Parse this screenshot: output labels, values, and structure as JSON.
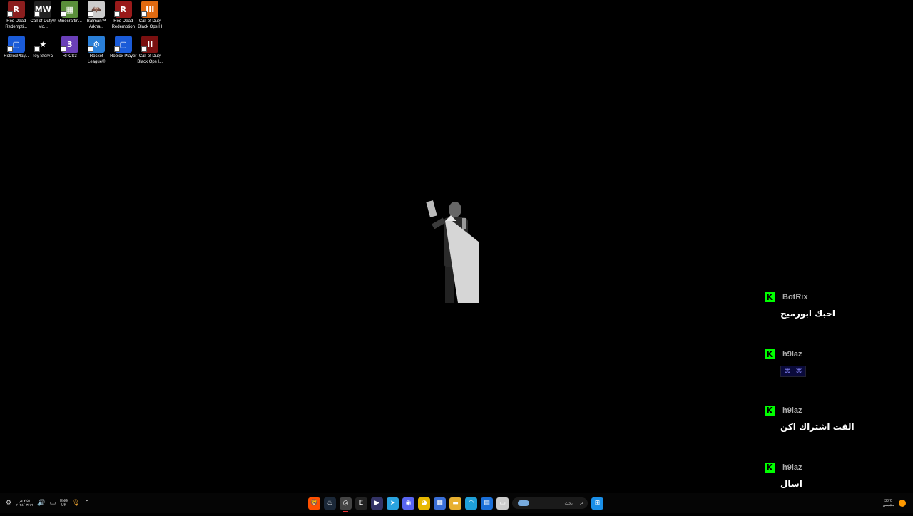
{
  "desktop": {
    "icons": [
      {
        "label": "Red Dead Redempti...",
        "icon": "red-dead-redemption-icon",
        "color": "#8b1e1e",
        "glyph": "R"
      },
      {
        "label": "Call of Duty® Mo...",
        "icon": "modern-warfare-icon",
        "color": "#222222",
        "glyph": "MW"
      },
      {
        "label": "Minecraftin...",
        "icon": "minecraft-icon",
        "color": "#5a8f3a",
        "glyph": "▦"
      },
      {
        "label": "Batman™ Arkha...",
        "icon": "batman-icon",
        "color": "#cccccc",
        "glyph": "🦇"
      },
      {
        "label": "Red Dead Redemption",
        "icon": "red-dead-redemption-icon",
        "color": "#9a1a1a",
        "glyph": "R"
      },
      {
        "label": "Call of Duty Black Ops III",
        "icon": "black-ops-iii-icon",
        "color": "#e06a10",
        "glyph": "III"
      },
      {
        "label": "RobloxPlay...",
        "icon": "roblox-icon",
        "color": "#1a5bd8",
        "glyph": "▢"
      },
      {
        "label": "Toy Story 3",
        "icon": "toy-story-icon",
        "color": "#000000",
        "glyph": "★"
      },
      {
        "label": "RPCS3",
        "icon": "rpcs3-icon",
        "color": "#6a3fb8",
        "glyph": "3"
      },
      {
        "label": "Rocket League®",
        "icon": "rocket-league-icon",
        "color": "#2a7fd8",
        "glyph": "⚙"
      },
      {
        "label": "Roblox Player",
        "icon": "roblox-icon",
        "color": "#1a5bd8",
        "glyph": "▢"
      },
      {
        "label": "Call of Duty Black Ops I...",
        "icon": "black-ops-icon",
        "color": "#7a1010",
        "glyph": "II"
      }
    ]
  },
  "chat": {
    "badge": "K",
    "badge_color": "#00ff00",
    "messages": [
      {
        "user": "BotRix",
        "text": "احبك ابورميح"
      },
      {
        "user": "h9laz",
        "text": "",
        "emotes": [
          "emote",
          "emote"
        ]
      },
      {
        "user": "h9laz",
        "text": "القت اشتراك اكن"
      },
      {
        "user": "h9laz",
        "text": "اسال"
      }
    ]
  },
  "taskbar": {
    "left": {
      "time": "٧:٥١ ص",
      "date": "٢٠٢٤/٠٣/١٦",
      "language": "ENG",
      "region": "UK"
    },
    "apps": [
      {
        "name": "brave-icon",
        "glyph": "🦁",
        "color": "#ff5000"
      },
      {
        "name": "steam-icon",
        "glyph": "♨",
        "color": "#1b2838"
      },
      {
        "name": "app-icon",
        "glyph": "◎",
        "color": "#444444",
        "active": true
      },
      {
        "name": "epic-icon",
        "glyph": "E",
        "color": "#222222"
      },
      {
        "name": "media-icon",
        "glyph": "▶",
        "color": "#333366"
      },
      {
        "name": "telegram-icon",
        "glyph": "➤",
        "color": "#2aa3e0"
      },
      {
        "name": "discord-icon",
        "glyph": "◉",
        "color": "#5865f2"
      },
      {
        "name": "chrome-icon",
        "glyph": "◕",
        "color": "#e8b800"
      },
      {
        "name": "calendar-icon",
        "glyph": "▦",
        "color": "#3a6fd8"
      },
      {
        "name": "file-explorer-icon",
        "glyph": "▬",
        "color": "#e8b030"
      },
      {
        "name": "edge-icon",
        "glyph": "◠",
        "color": "#1fa0d8"
      },
      {
        "name": "store-icon",
        "glyph": "▤",
        "color": "#1a6fd8"
      },
      {
        "name": "notepad-icon",
        "glyph": "▭",
        "color": "#cccccc"
      }
    ],
    "search_placeholder": "بحث",
    "weather": {
      "temp": "38°C",
      "desc": "مشمس"
    }
  }
}
